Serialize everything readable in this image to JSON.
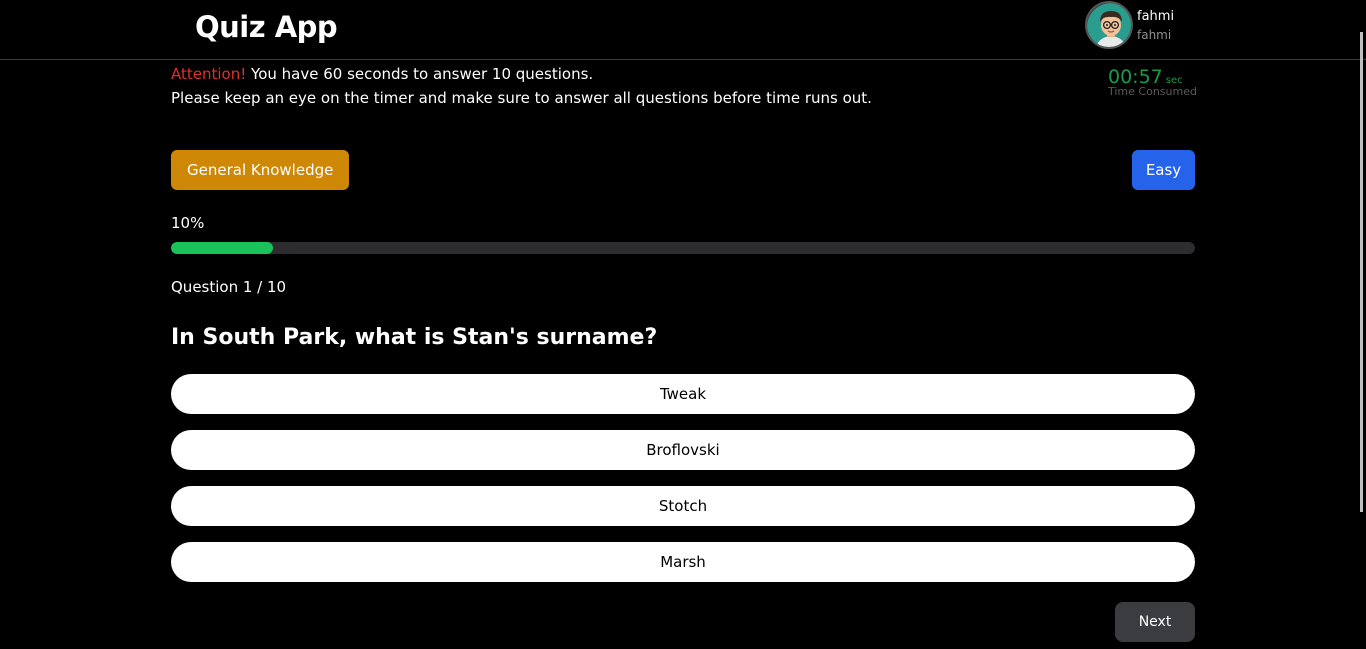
{
  "header": {
    "app_title": "Quiz App",
    "user": {
      "name": "fahmi",
      "handle": "fahmi",
      "avatar_icon": "avatar-cartoon-glasses-icon"
    }
  },
  "notice": {
    "attention_label": "Attention!",
    "line1_rest": " You have 60 seconds to answer 10 questions.",
    "line2": "Please keep an eye on the timer and make sure to answer all questions before time runs out."
  },
  "timer": {
    "value": "00:57",
    "unit": "sec",
    "label": "Time Consumed",
    "color": "#1a9a4a"
  },
  "quiz": {
    "category": "General Knowledge",
    "category_color": "#cf8706",
    "difficulty": "Easy",
    "difficulty_color": "#2563eb",
    "progress_text": "10%",
    "progress_fraction": 0.1,
    "progress_color": "#19c25a",
    "counter": "Question 1 / 10",
    "question": "In South Park, what is Stan's surname?",
    "options": [
      "Tweak",
      "Broflovski",
      "Stotch",
      "Marsh"
    ],
    "next_label": "Next"
  }
}
